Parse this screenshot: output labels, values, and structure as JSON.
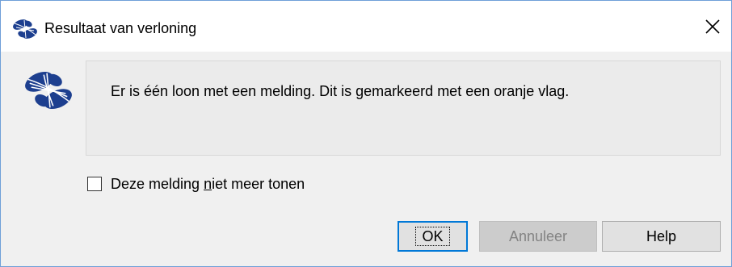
{
  "window": {
    "title": "Resultaat van verloning",
    "close_glyph": "✕",
    "app_icon": "butterfly-logo-icon"
  },
  "dialog": {
    "icon": "butterfly-logo-icon",
    "message": "Er is één loon met een melding. Dit is gemarkeerd met een oranje vlag.",
    "checkbox": {
      "label_before": "Deze melding ",
      "label_mnemonic": "n",
      "label_after": "iet meer tonen",
      "checked": false
    }
  },
  "buttons": {
    "ok": "OK",
    "cancel": "Annuleer",
    "help": "Help"
  },
  "colors": {
    "logo_blue": "#1d3f8f",
    "focus_blue": "#0078d7",
    "window_border": "#6f9fd8"
  }
}
